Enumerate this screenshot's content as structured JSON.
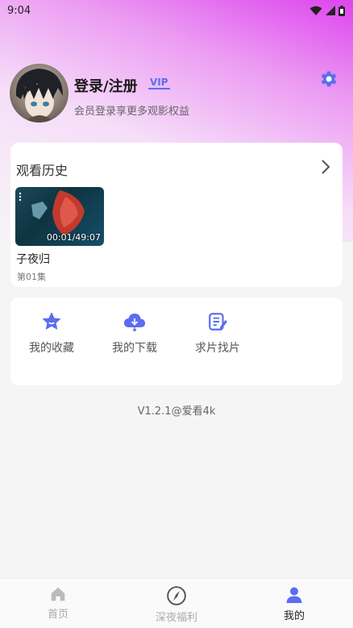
{
  "status_bar": {
    "time": "9:04"
  },
  "profile": {
    "title": "登录/注册",
    "vip_label": "VIP",
    "subtitle": "会员登录享更多观影权益"
  },
  "history": {
    "title": "观看历史",
    "items": [
      {
        "title": "子夜归",
        "episode": "第01集",
        "time": "00:01/49:07"
      }
    ]
  },
  "actions": [
    {
      "label": "我的收藏",
      "icon": "star-icon"
    },
    {
      "label": "我的下载",
      "icon": "cloud-download-icon"
    },
    {
      "label": "求片找片",
      "icon": "request-edit-icon"
    }
  ],
  "version": "V1.2.1@爱看4k",
  "tabs": [
    {
      "label": "首页",
      "icon": "home-icon"
    },
    {
      "label": "深夜福利",
      "icon": "compass-icon"
    },
    {
      "label": "我的",
      "icon": "person-icon"
    }
  ],
  "colors": {
    "accent": "#5b6df0",
    "gradient_top": "#dd44ee"
  }
}
